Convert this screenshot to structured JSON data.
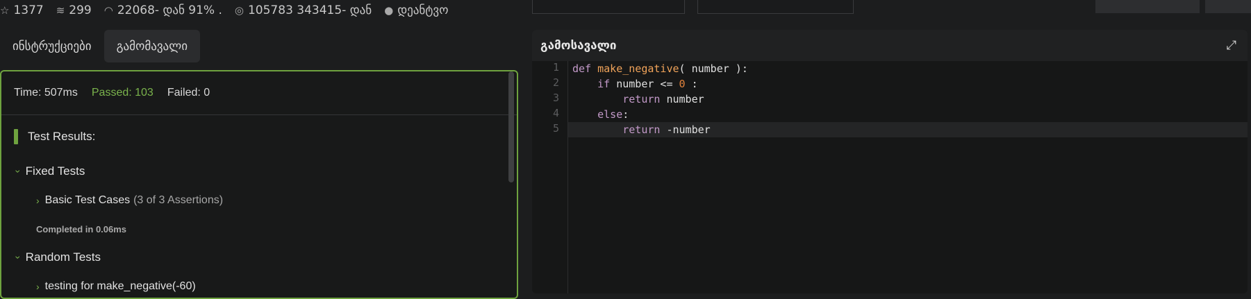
{
  "stats": {
    "stars": "1377",
    "collections": "299",
    "completion": "22068- დან 91% .",
    "views": "105783 343415- დან",
    "author": "დეანტვო"
  },
  "icons": {
    "stars": "star-icon",
    "collections": "layers-icon",
    "completion": "eye-icon",
    "views": "target-icon",
    "author": "user-icon",
    "expand": "expand-icon",
    "chevron": "chevron-icon"
  },
  "tabs": [
    {
      "label": "ინსტრუქციები",
      "active": false
    },
    {
      "label": "გამომავალი",
      "active": true
    }
  ],
  "results": {
    "time": "Time: 507ms",
    "passed": "Passed: 103",
    "failed": "Failed: 0",
    "heading": "Test Results:",
    "groups": [
      {
        "label": "Fixed Tests",
        "expanded": true,
        "items": [
          {
            "label": "Basic Test Cases",
            "assertions": "(3 of 3 Assertions)"
          }
        ],
        "completed": "Completed in 0.06ms"
      },
      {
        "label": "Random Tests",
        "expanded": true,
        "items": [
          {
            "label": "testing for make_negative(-60)"
          }
        ]
      }
    ]
  },
  "editor": {
    "title": "გამოსავალი",
    "line_numbers": [
      "1",
      "2",
      "3",
      "4",
      "5"
    ]
  },
  "colors": {
    "accent": "#6fa33f",
    "passed": "#7ab34c",
    "keyword": "#c39ac9",
    "function": "#f0a35a",
    "number": "#e3833c"
  }
}
